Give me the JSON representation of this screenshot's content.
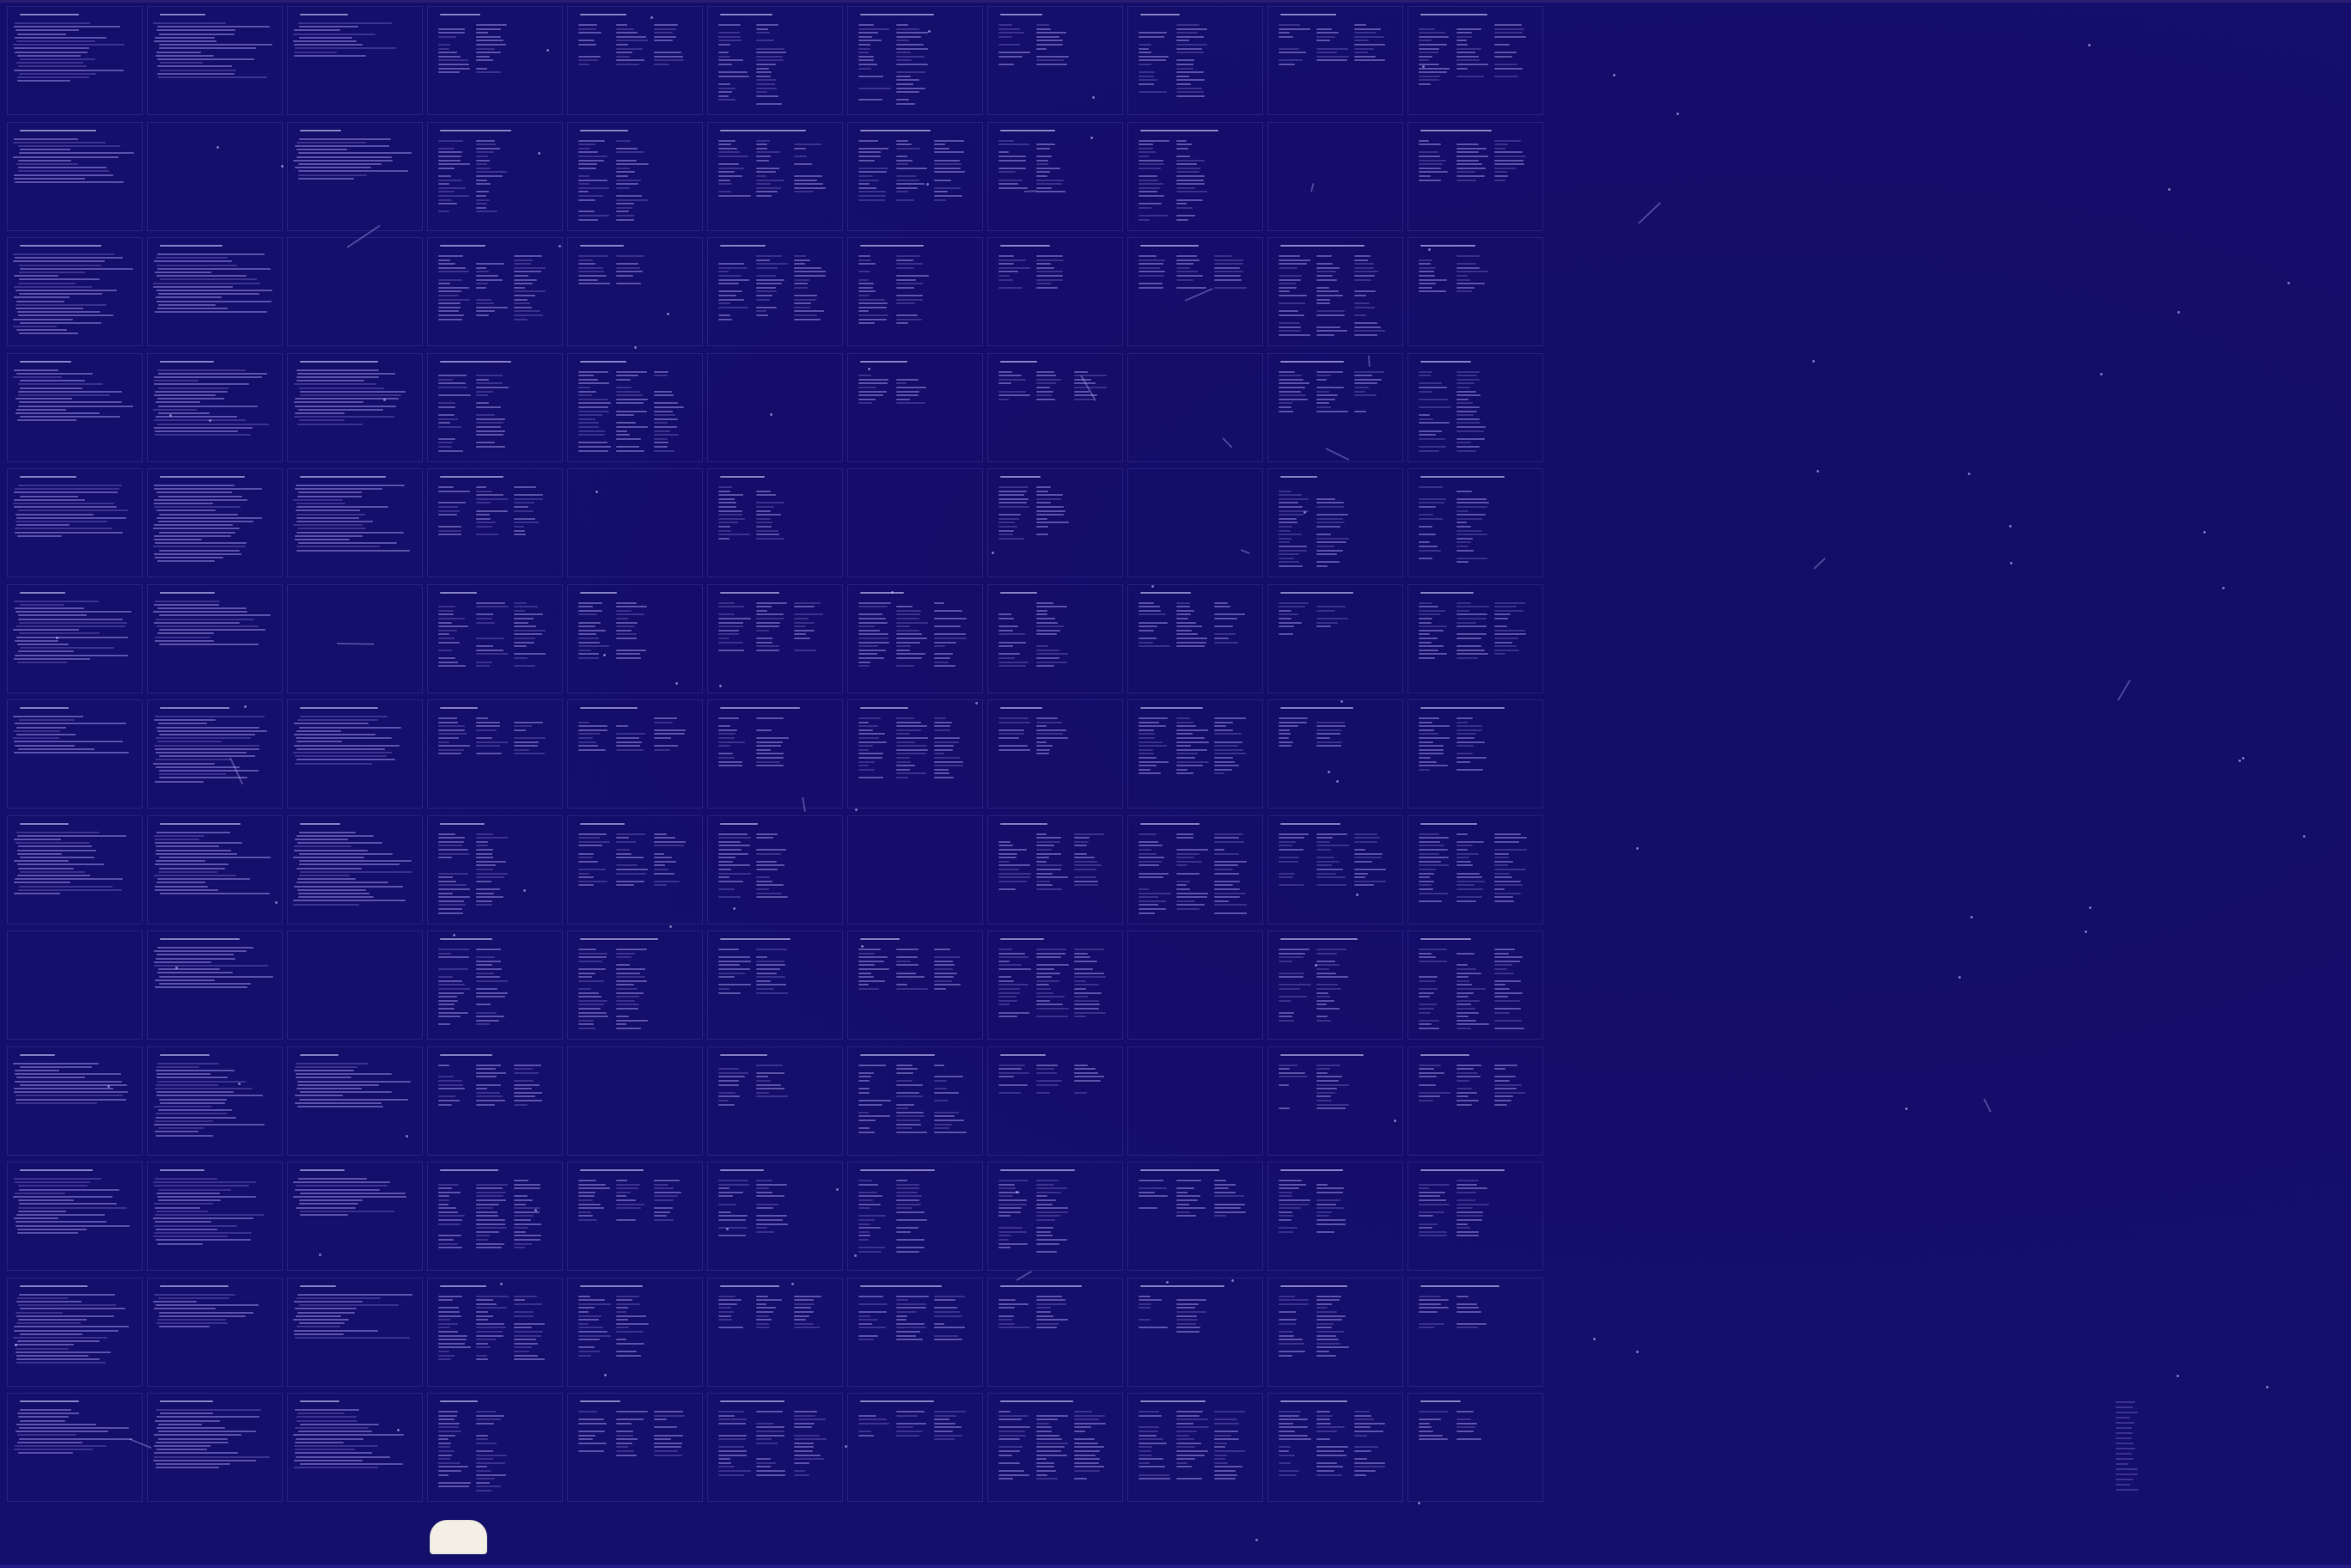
{
  "fiche": {
    "background_color": "#150f6c",
    "text_color": "#aaa0f0",
    "rows": 13,
    "cols": 11,
    "blank_frames": [
      [
        1,
        1
      ],
      [
        1,
        9
      ],
      [
        2,
        2
      ],
      [
        3,
        5
      ],
      [
        3,
        8
      ],
      [
        4,
        4
      ],
      [
        4,
        6
      ],
      [
        4,
        8
      ],
      [
        5,
        2
      ],
      [
        7,
        6
      ],
      [
        8,
        0
      ],
      [
        8,
        2
      ],
      [
        8,
        8
      ],
      [
        9,
        4
      ],
      [
        9,
        8
      ]
    ],
    "notch": "light-notch"
  }
}
